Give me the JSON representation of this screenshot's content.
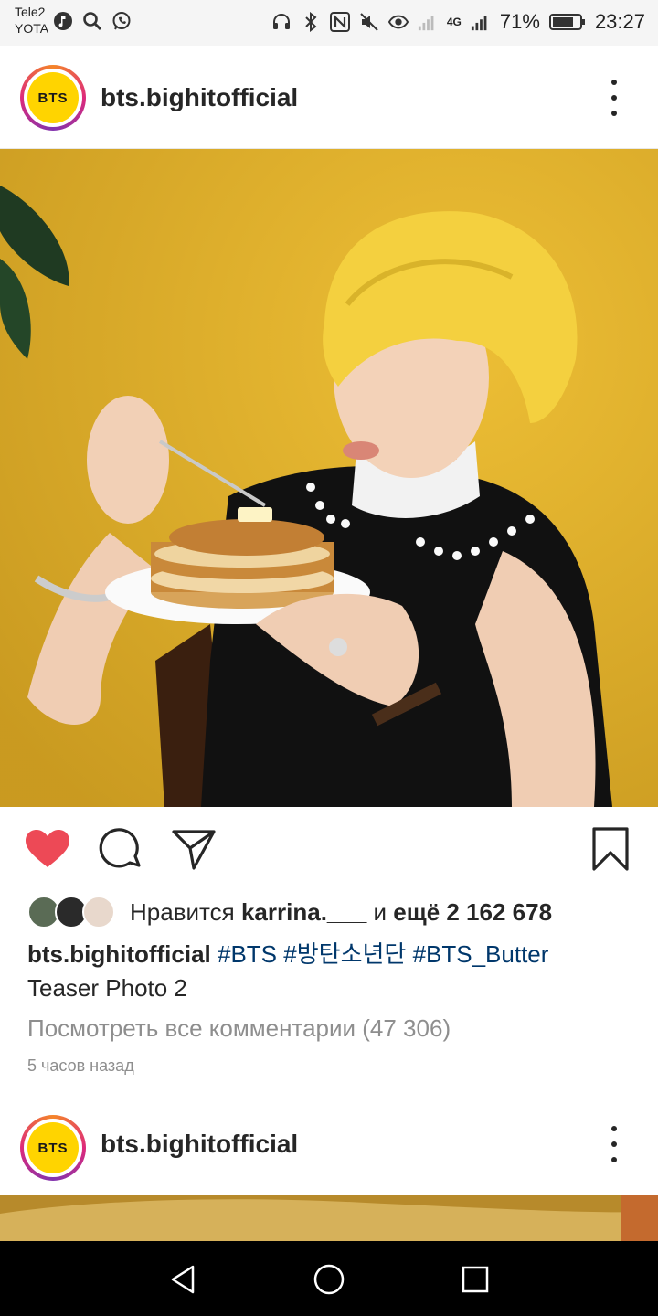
{
  "status_bar": {
    "carrier_1": "Tele2",
    "carrier_2": "YOTA",
    "network": "4G",
    "battery": "71%",
    "time": "23:27"
  },
  "post": {
    "avatar_text": "BTS",
    "username": "bts.bighitofficial",
    "liked_prefix": "Нравится",
    "liked_user": "karrina.___",
    "liked_and": "и",
    "liked_more": "ещё 2 162 678",
    "caption_user": "bts.bighitofficial",
    "hashtags": [
      "#BTS",
      "#방탄소년단",
      "#BTS_Butter"
    ],
    "caption_text": "Teaser Photo 2",
    "view_comments": "Посмотреть все комментарии (47 306)",
    "timestamp": "5 часов назад"
  },
  "next_post": {
    "avatar_text": "BTS",
    "username": "bts.bighitofficial"
  },
  "colors": {
    "like": "#ed4956",
    "hashtag": "#00376b",
    "muted": "#8e8e8e",
    "photo_bg": "#e8b624"
  },
  "icons": {
    "like": "heart-icon",
    "comment": "comment-icon",
    "share": "paper-plane-icon",
    "save": "bookmark-icon",
    "more": "more-vertical-icon"
  }
}
